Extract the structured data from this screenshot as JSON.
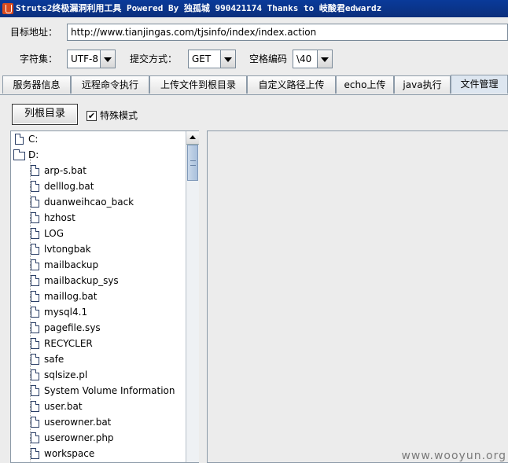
{
  "window": {
    "title": "Struts2终极漏洞利用工具   Powered By 独孤城 990421174 Thanks to 岐酸君edwardz"
  },
  "form": {
    "target_url_label": "目标地址：",
    "target_url_value": "http://www.tianjingas.com/tjsinfo/index/index.action",
    "charset_label": "字符集：",
    "charset_value": "UTF-8",
    "method_label": "提交方式：",
    "method_value": "GET",
    "space_encoding_label": "空格编码",
    "space_encoding_value": "\\40"
  },
  "tabs": [
    {
      "label": "服务器信息"
    },
    {
      "label": "远程命令执行"
    },
    {
      "label": "上传文件到根目录"
    },
    {
      "label": "自定义路径上传"
    },
    {
      "label": "echo上传"
    },
    {
      "label": "java执行"
    },
    {
      "label": "文件管理",
      "active": true
    }
  ],
  "file_manager": {
    "list_root_button": "列根目录",
    "special_mode_label": "特殊模式",
    "special_mode_checked": true,
    "tree": {
      "drives": [
        {
          "label": "C:",
          "icon": "file-icon"
        },
        {
          "label": "D:",
          "icon": "folder-open-icon"
        }
      ],
      "children": [
        "arp-s.bat",
        "delllog.bat",
        "duanweihcao_back",
        "hzhost",
        "LOG",
        "lvtongbak",
        "mailbackup",
        "mailbackup_sys",
        "maillog.bat",
        "mysql4.1",
        "pagefile.sys",
        "RECYCLER",
        "safe",
        "sqlsize.pl",
        "System Volume Information",
        "user.bat",
        "userowner.bat",
        "userowner.php",
        "workspace"
      ]
    }
  },
  "watermark": "www.wooyun.org"
}
